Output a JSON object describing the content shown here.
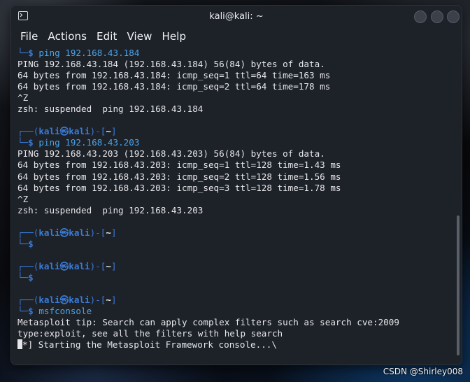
{
  "window": {
    "title": "kali@kali: ~"
  },
  "menu": [
    "File",
    "Actions",
    "Edit",
    "View",
    "Help"
  ],
  "prompt": {
    "user_host": "kali㉿kali",
    "dir": "~"
  },
  "terminal": {
    "cmd1": "ping 192.168.43.184",
    "out1": [
      "PING 192.168.43.184 (192.168.43.184) 56(84) bytes of data.",
      "64 bytes from 192.168.43.184: icmp_seq=1 ttl=64 time=163 ms",
      "64 bytes from 192.168.43.184: icmp_seq=2 ttl=64 time=178 ms",
      "^Z",
      "zsh: suspended  ping 192.168.43.184"
    ],
    "cmd2": "ping 192.168.43.203",
    "out2": [
      "PING 192.168.43.203 (192.168.43.203) 56(84) bytes of data.",
      "64 bytes from 192.168.43.203: icmp_seq=1 ttl=128 time=1.43 ms",
      "64 bytes from 192.168.43.203: icmp_seq=2 ttl=128 time=1.56 ms",
      "64 bytes from 192.168.43.203: icmp_seq=3 ttl=128 time=1.78 ms",
      "^Z",
      "zsh: suspended  ping 192.168.43.203"
    ],
    "cmd5": "msfconsole",
    "out5": [
      "Metasploit tip: Search can apply complex filters such as search cve:2009",
      "type:exploit, see all the filters with help search"
    ],
    "starting": "*] Starting the Metasploit Framework console...\\"
  },
  "watermark": "CSDN @Shirley008",
  "colors": {
    "accent": "#3a7bd6",
    "command": "#4ca3e8",
    "background": "#1d2128"
  }
}
